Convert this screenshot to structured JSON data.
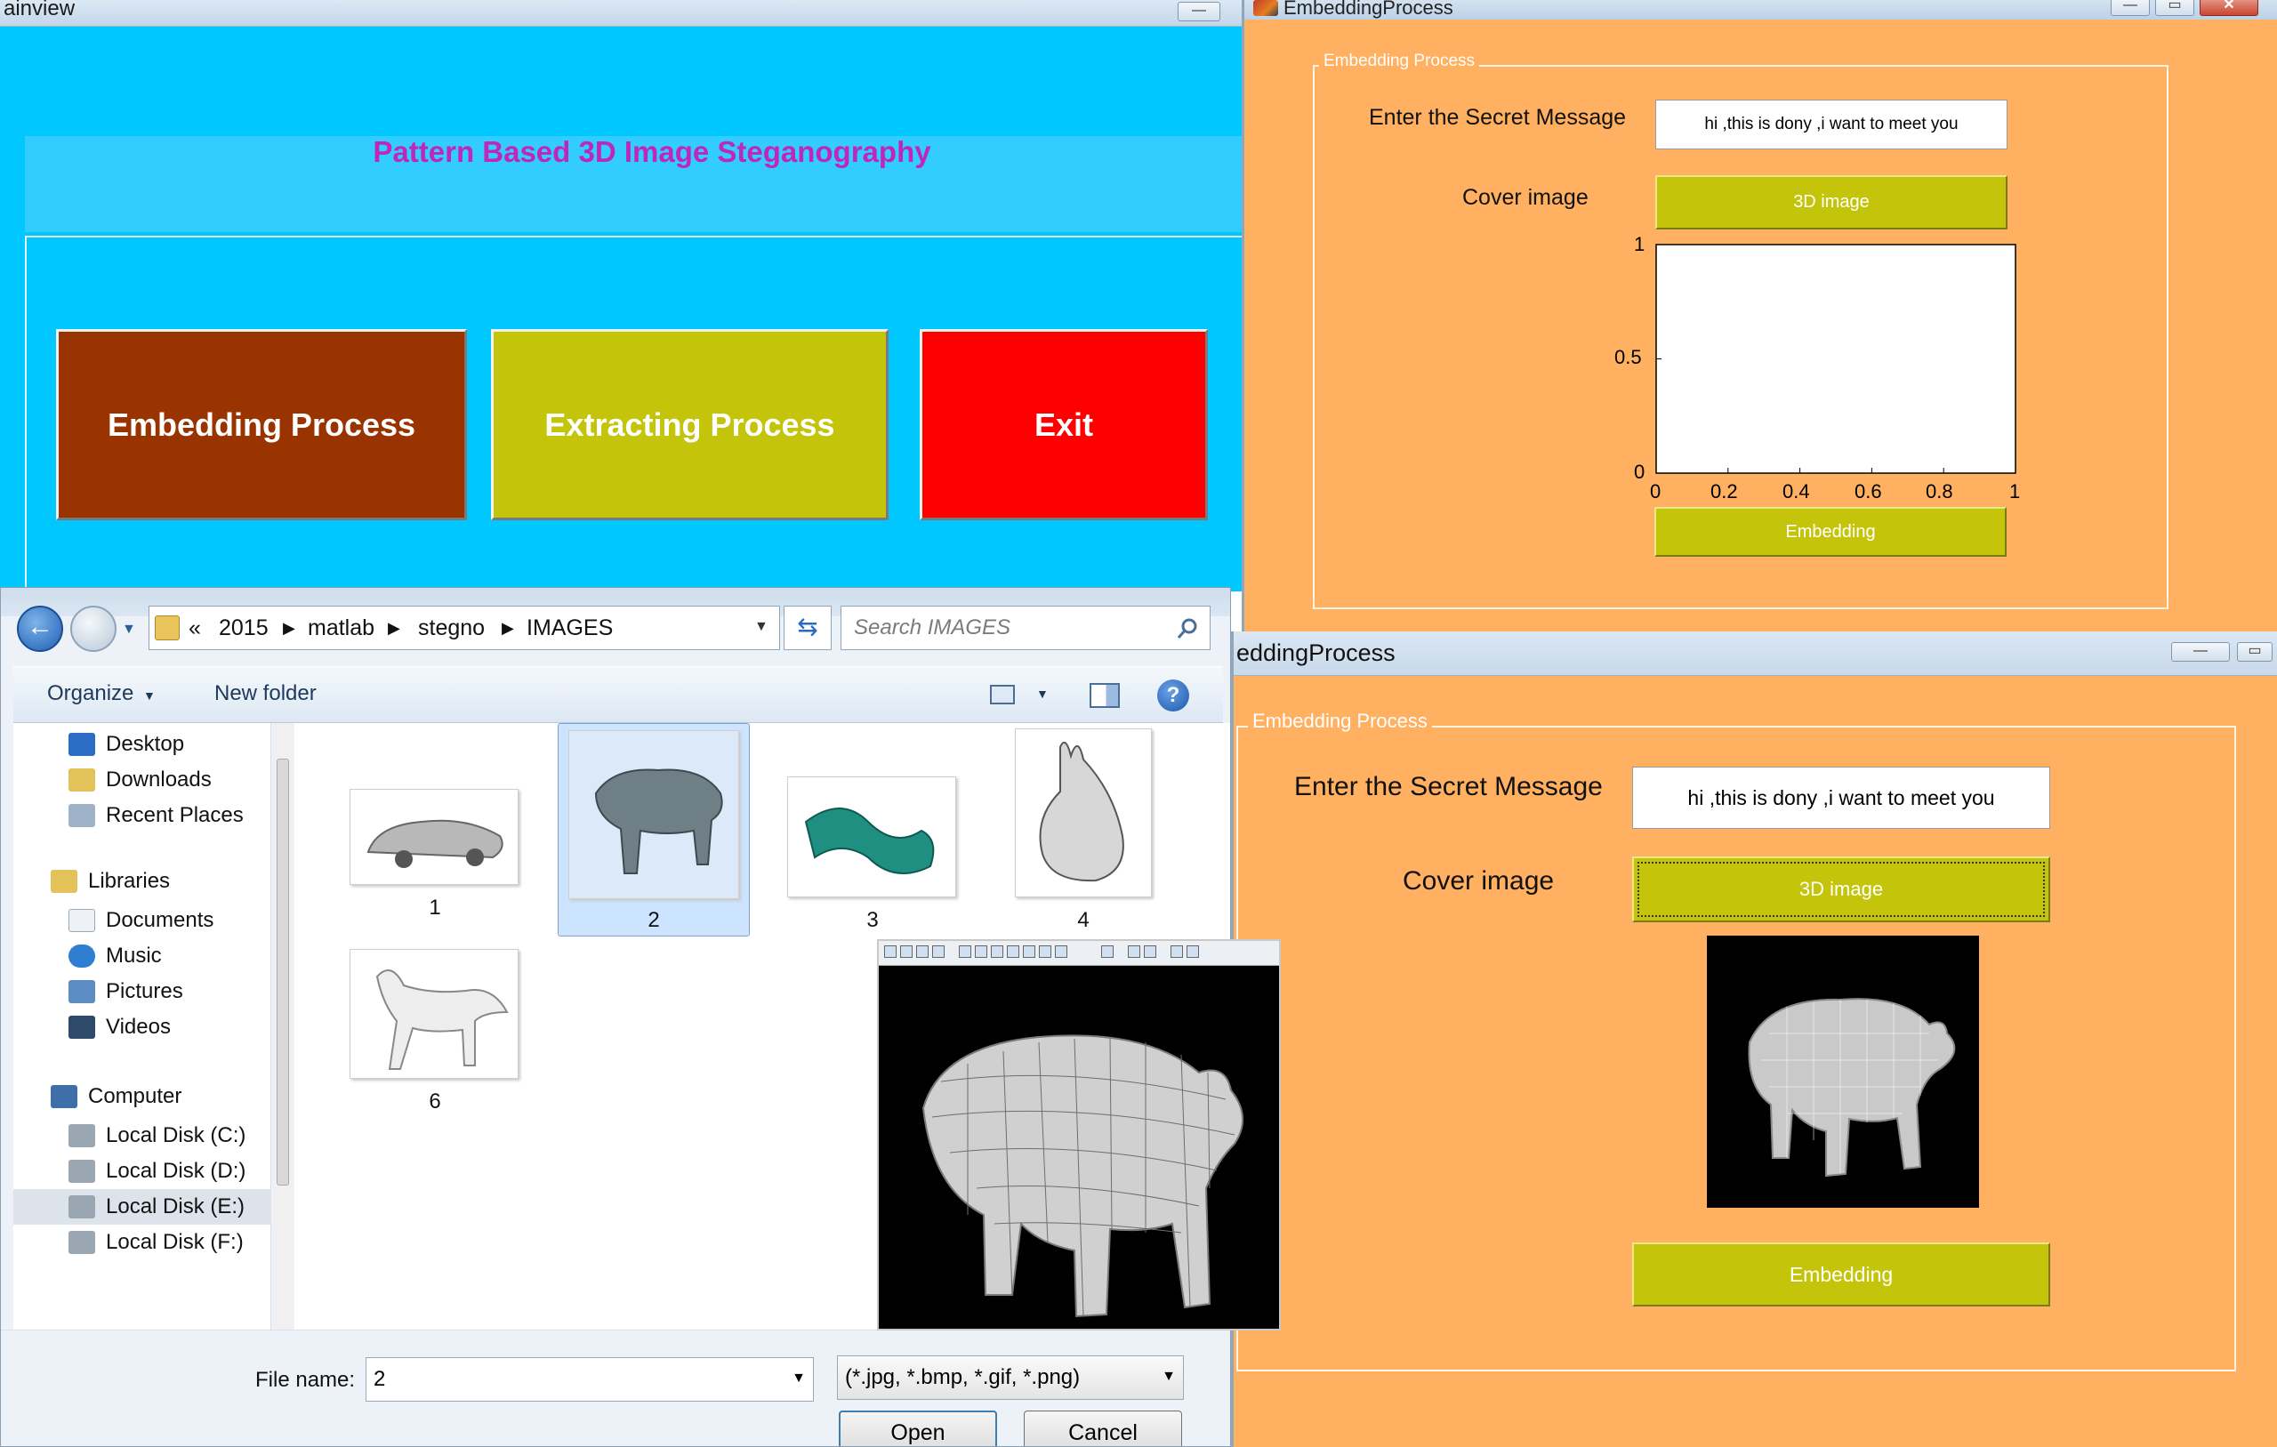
{
  "main_window": {
    "title": "ainview",
    "minimize": "—",
    "heading": "Pattern Based 3D Image Steganography",
    "buttons": {
      "embedding": "Embedding Process",
      "extracting": "Extracting Process",
      "exit": "Exit"
    },
    "colors": {
      "background": "#00c8ff",
      "heading": "#c026b8",
      "embedding": "#993300",
      "extracting": "#c4c40a",
      "exit": "#ff0000"
    }
  },
  "embedding_window_top": {
    "title": "EmbeddingProcess",
    "group_title": "Embedding Process",
    "secret_label": "Enter the Secret Message",
    "secret_value": "hi ,this is dony ,i want to meet you",
    "cover_label": "Cover  image",
    "cover_button": "3D image",
    "embed_button": "Embedding",
    "window_buttons": {
      "minimize": "—",
      "maximize": "▭",
      "close": "✕"
    },
    "axes": {
      "y_ticks": [
        "1",
        "0.5",
        "0"
      ],
      "x_ticks": [
        "0",
        "0.2",
        "0.4",
        "0.6",
        "0.8",
        "1"
      ],
      "xlim": [
        0,
        1
      ],
      "ylim": [
        0,
        1
      ]
    },
    "colors": {
      "background": "#ffb060",
      "button": "#c4c40a"
    }
  },
  "embedding_window_bottom": {
    "title": "eddingProcess",
    "group_title": "Embedding Process",
    "secret_label": "Enter the Secret Message",
    "secret_value": "hi ,this is dony ,i want to meet you",
    "cover_label": "Cover  image",
    "cover_button": "3D image",
    "embed_button": "Embedding",
    "window_buttons": {
      "minimize": "—",
      "maximize": "▭"
    },
    "image": "bear-mesh-icon"
  },
  "file_dialog": {
    "breadcrumb": [
      "«",
      "2015",
      "matlab",
      "stegno",
      "IMAGES"
    ],
    "search_placeholder": "Search IMAGES",
    "toolbar": {
      "organize": "Organize",
      "new_folder": "New folder",
      "help": "?"
    },
    "nav": {
      "favorites": [
        "Desktop",
        "Downloads",
        "Recent Places"
      ],
      "libraries_header": "Libraries",
      "libraries": [
        "Documents",
        "Music",
        "Pictures",
        "Videos"
      ],
      "computer_header": "Computer",
      "drives": [
        "Local Disk (C:)",
        "Local Disk (D:)",
        "Local Disk (E:)",
        "Local Disk (F:)"
      ],
      "selected": "Local Disk (E:)"
    },
    "files": [
      {
        "label": "1",
        "icon": "car-mesh-icon"
      },
      {
        "label": "2",
        "icon": "bear-mesh-icon",
        "selected": true
      },
      {
        "label": "3",
        "icon": "dragon-mesh-icon"
      },
      {
        "label": "4",
        "icon": "bunny-mesh-icon"
      },
      {
        "label": "6",
        "icon": "horse-mesh-icon"
      }
    ],
    "file_name_label": "File name:",
    "file_name_value": "2",
    "file_type": "(*.jpg, *.bmp, *.gif, *.png)",
    "open_button": "Open",
    "cancel_button": "Cancel"
  },
  "preview_figure": {
    "image": "bear-mesh-icon"
  }
}
